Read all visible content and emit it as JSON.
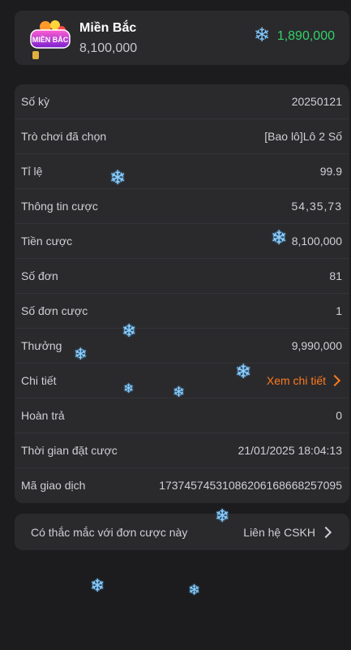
{
  "header": {
    "title": "Miền Bắc",
    "amount": "8,100,000",
    "balance": "1,890,000",
    "logo_text": "MIỀN BẮC",
    "balance_color": "#32d36a"
  },
  "details": [
    {
      "label": "Số kỳ",
      "value": "20250121"
    },
    {
      "label": "Trò chơi đã chọn",
      "value": "[Bao lô]Lô 2 Số"
    },
    {
      "label": "Tỉ lệ",
      "value": "99.9"
    },
    {
      "label": "Thông tin cược",
      "value": "54,35,73"
    },
    {
      "label": "Tiền cược",
      "value": "8,100,000"
    },
    {
      "label": "Số đơn",
      "value": "81"
    },
    {
      "label": "Số đơn cược",
      "value": "1"
    },
    {
      "label": "Thưởng",
      "value": "9,990,000"
    },
    {
      "label": "Chi tiết",
      "value": "Xem chi tiết"
    },
    {
      "label": "Hoàn trả",
      "value": "0"
    },
    {
      "label": "Thời gian đặt cược",
      "value": "21/01/2025 18:04:13"
    },
    {
      "label": "Mã giao dịch",
      "value": "17374574531086206168668257095"
    }
  ],
  "contact": {
    "question": "Có thắc mắc với đơn cược này",
    "link": "Liên hệ CSKH"
  },
  "accent_color": "#ff7a1c",
  "decor_icon": "snowflake-icon"
}
